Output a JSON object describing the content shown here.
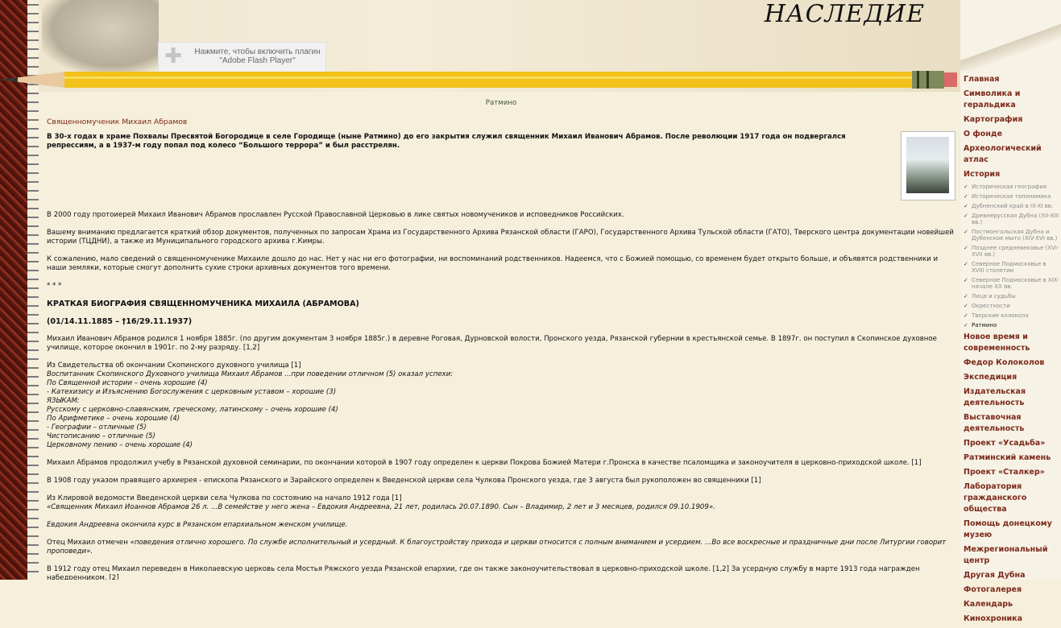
{
  "header": {
    "brand": "НАСЛЕДИЕ",
    "flash_text_1": "Нажмите, чтобы включить плагин",
    "flash_text_2": "\"Adobe Flash Player\""
  },
  "nav": {
    "items": [
      "Главная",
      "Символика и геральдика",
      "Картография",
      "О фонде",
      "Археологический атлас",
      "История"
    ],
    "sub": [
      "Историческая география",
      "Историческая топонимика",
      "Дубненский край в IX-XI вв.",
      "Древнерусская Дубна (XII-XIII вв.)",
      "Постмонгольская Дубна и Дубенское мыто (XIV-XVI вв.)",
      "Позднее средневековье (XVI-XVII вв.)",
      "Северное Подмосковье в XVIII столетии",
      "Северное Подмосковье в XIX-начале XX вв.",
      "Лица и судьбы",
      "Окрестности",
      "Тверские колокола",
      "Ратмино"
    ],
    "items2": [
      "Новое время и современность",
      "Федор Колоколов",
      "Экспедиция",
      "Издательская деятельность",
      "Выставочная деятельность",
      "Проект «Усадьба»",
      "Ратминский камень",
      "Проект «Сталкер»",
      "Лаборатория гражданского общества",
      "Помощь донецкому музею",
      "Межрегиональный центр",
      "Другая Дубна",
      "Фотогалерея",
      "Календарь",
      "Кинохроника"
    ]
  },
  "article": {
    "breadcrumb": "Ратмино",
    "title": "Священномученик Михаил Абрамов",
    "lead": "В 30-х годах в храме Похвалы Пресвятой Богородице в селе Городище (ныне Ратмино) до его закрытия служил священник Михаил Иванович Абрамов. После революции 1917 года он подвергался репрессиям, а в 1937-м году попал под колесо “Большого террора” и был расстрелян.",
    "p1": "В 2000 году протоиерей Михаил Иванович Абрамов прославлен Русской Православной Церковью в лике святых новомучеников и исповедников Российских.",
    "p2": "Вашему вниманию предлагается краткий обзор документов, полученных по запросам Храма из Государственного Архива Рязанской области (ГАРО), Государственного Архива Тульской области (ГАТО), Тверского центра документации новейшей истории (ТЦДНИ), а также из Муниципального городского архива г.Кимры.",
    "p3": "К сожалению, мало сведений о священномученике Михаиле дошло до нас. Нет у нас ни его фотографии, ни воспоминаний родственников. Надеемся, что с Божией помощью, со временем будет открыто больше, и объявятся родственники и наши земляки, которые смогут дополнить сухие строки архивных документов того времени.",
    "stars": "* * *",
    "h1": "КРАТКАЯ БИОГРАФИЯ СВЯЩЕННОМУЧЕНИКА МИХАИЛА (АБРАМОВА)",
    "h2": "(01/14.11.1885 – †16/29.11.1937)",
    "p4": "Михаил Иванович Абрамов родился 1 ноября 1885г. (по другим документам 3 ноября 1885г.) в деревне Роговая, Дурновской волости, Пронского уезда, Рязанской губернии в крестьянской семье. В 1897г. он поступил в Скопинское духовное училище, которое окончил в 1901г. по 2-му разряду. [1,2]",
    "p5": "Из Свидетельства об окончании Скопинского духовного училища [1]",
    "quote1": [
      "Воспитанник Скопинского Духовного училища Михаил Абрамов ...при поведении отличном (5) оказал успехи:",
      "По Священной истории – очень хорошие (4)",
      "- Катехизису и Изъяснению Богослужения с церковным уставом – хорошие (3)",
      "ЯЗЫКАМ:",
      "Русскому с церковно-славянским, греческому, латинскому – очень хорошие (4)",
      "По Арифметике – очень хорошие (4)",
      "- Географии – отличные (5)",
      "Чистописанию – отличные (5)",
      "Церковному пению – очень хорошие (4)"
    ],
    "p6": "Михаил Абрамов продолжил учебу в Рязанской духовной семинарии, по окончании которой в 1907 году определен к церкви Покрова Божией Матери г.Пронска в качестве псаломщика и законоучителя в церковно-приходской школе. [1]",
    "p7": "В 1908 году указом правящего архиерея - епископа Рязанского и Зарайского определен к Введенской церкви села Чулкова Пронского уезда, где 3 августа был рукоположен во священники [1]",
    "p8": "Из Клировой ведомости Введенской церкви села Чулкова по состоянию на начало 1912 года [1]",
    "quote2": "«Священник Михаил Иоаннов Абрамов 26 л. ...В семействе у него жена – Евдокия Андреевна, 21 лет, родилась 20.07.1890. Сын – Владимир, 2 лет и 3 месяцев, родился 09.10.1909».",
    "quote3": "Евдокия Андреевна окончила курс в Рязанском епархиальном женском училище.",
    "p9_plain": "Отец Михаил отмечен ",
    "p9_ital": "«поведения отлично хорошего. По службе исполнительный и усердный. К благоустройству прихода и церкви относится с полным вниманием и усердием. ...Во все воскресные и праздничные дни после Литургии говорит проповеди».",
    "p10": "В 1912 году отец Михаил переведен в Николаевскую церковь села Мостья Ряжского уезда Рязанской епархии, где он также законоучительствовал в церковно-приходской школе. [1,2] За усердную службу в марте 1913 года награжден набедренником. [2]"
  }
}
